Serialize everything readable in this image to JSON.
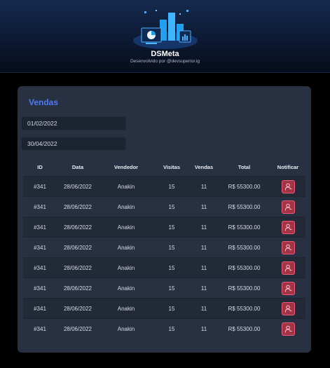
{
  "header": {
    "title": "DSMeta",
    "subtitle": "Desenvolvido por @devsuperior.ig",
    "logo_icon": "dashboard-illustration-icon"
  },
  "sales": {
    "title": "Vendas",
    "date_min": "01/02/2022",
    "date_max": "30/04/2022",
    "columns": [
      "ID",
      "Data",
      "Vendedor",
      "Visitas",
      "Vendas",
      "Total",
      "Notificar"
    ],
    "rows": [
      {
        "id": "#341",
        "date": "28/06/2022",
        "seller": "Anakin",
        "visits": "15",
        "deals": "11",
        "amount": "R$ 55300.00"
      },
      {
        "id": "#341",
        "date": "28/06/2022",
        "seller": "Anakin",
        "visits": "15",
        "deals": "11",
        "amount": "R$ 55300.00"
      },
      {
        "id": "#341",
        "date": "28/06/2022",
        "seller": "Anakin",
        "visits": "15",
        "deals": "11",
        "amount": "R$ 55300.00"
      },
      {
        "id": "#341",
        "date": "28/06/2022",
        "seller": "Anakin",
        "visits": "15",
        "deals": "11",
        "amount": "R$ 55300.00"
      },
      {
        "id": "#341",
        "date": "28/06/2022",
        "seller": "Anakin",
        "visits": "15",
        "deals": "11",
        "amount": "R$ 55300.00"
      },
      {
        "id": "#341",
        "date": "28/06/2022",
        "seller": "Anakin",
        "visits": "15",
        "deals": "11",
        "amount": "R$ 55300.00"
      },
      {
        "id": "#341",
        "date": "28/06/2022",
        "seller": "Anakin",
        "visits": "15",
        "deals": "11",
        "amount": "R$ 55300.00"
      },
      {
        "id": "#341",
        "date": "28/06/2022",
        "seller": "Anakin",
        "visits": "15",
        "deals": "11",
        "amount": "R$ 55300.00"
      }
    ],
    "notify_icon": "user-notify-icon"
  },
  "colors": {
    "accent": "#4d7bf3",
    "notify_bg": "#a23446",
    "notify_border": "#ee5a77",
    "card_bg": "#283142",
    "page_bg": "#000000",
    "header_bg": "#142a4e"
  }
}
